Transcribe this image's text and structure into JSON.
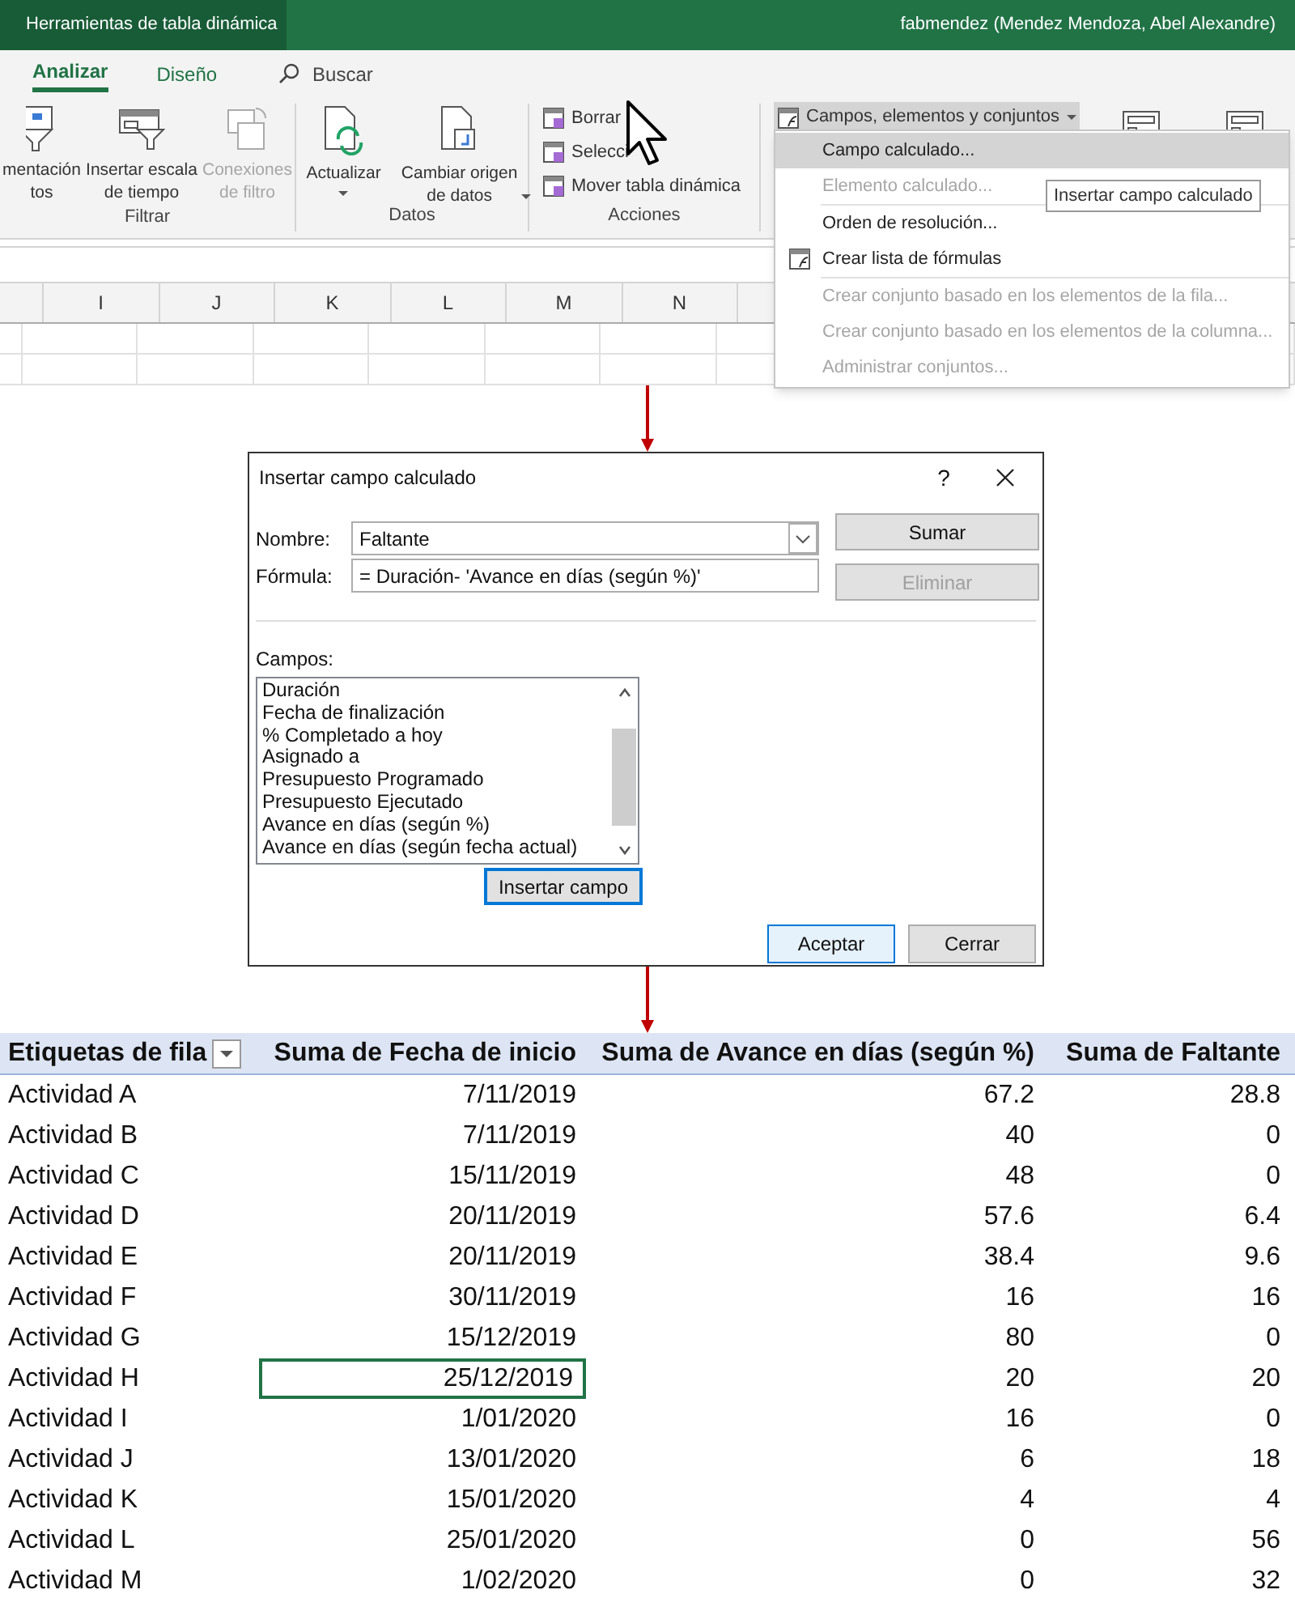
{
  "title_bar": {
    "context_tab": "Herramientas de tabla dinámica",
    "user": "fabmendez (Mendez Mendoza, Abel Alexandre)"
  },
  "ribbon_tabs": [
    {
      "label": "Analizar",
      "selected": true
    },
    {
      "label": "Diseño",
      "selected": false
    }
  ],
  "search": {
    "placeholder": "Buscar"
  },
  "ribbon_groups": [
    {
      "label": "Filtrar",
      "commands": [
        {
          "kind": "slicer",
          "lines": [
            "mentación",
            "tos"
          ],
          "disabled": false
        },
        {
          "kind": "timeline",
          "lines": [
            "Insertar escala",
            "de tiempo"
          ],
          "disabled": false
        },
        {
          "kind": "connections",
          "lines": [
            "Conexiones",
            "de filtro"
          ],
          "disabled": true
        }
      ]
    },
    {
      "label": "Datos",
      "commands": [
        {
          "kind": "refresh",
          "lines": [
            "Actualizar"
          ],
          "dropdown": true,
          "disabled": false
        },
        {
          "kind": "source",
          "lines": [
            "Cambiar origen",
            "de datos"
          ],
          "dropdown": true,
          "disabled": false
        }
      ]
    },
    {
      "label": "Acciones",
      "commands": [
        {
          "kind": "small",
          "lines": [
            "Borrar"
          ],
          "disabled": false
        },
        {
          "kind": "small",
          "lines": [
            "Selecci"
          ],
          "disabled": false
        },
        {
          "kind": "small",
          "lines": [
            "Mover tabla dinámica"
          ],
          "disabled": false
        }
      ]
    }
  ],
  "fields_button": {
    "label": "Campos, elementos y conjuntos",
    "expanded": true
  },
  "columns": [
    "I",
    "J",
    "K",
    "L",
    "M",
    "N"
  ],
  "menu": [
    {
      "label": "Campo calculado...",
      "selected": true,
      "disabled": false,
      "separator_before": false
    },
    {
      "label": "Elemento calculado...",
      "selected": false,
      "disabled": true,
      "separator_before": false
    },
    {
      "label": "Orden de resolución...",
      "selected": false,
      "disabled": false,
      "separator_before": true
    },
    {
      "label": "Crear lista de fórmulas",
      "selected": false,
      "disabled": false,
      "separator_before": false,
      "icon": true
    },
    {
      "label": "Crear conjunto basado en los elementos de la fila...",
      "selected": false,
      "disabled": true,
      "separator_before": true
    },
    {
      "label": "Crear conjunto basado en los elementos de la columna...",
      "selected": false,
      "disabled": true,
      "separator_before": false
    },
    {
      "label": "Administrar conjuntos...",
      "selected": false,
      "disabled": true,
      "separator_before": false
    }
  ],
  "tooltip": "Insertar campo calculado",
  "dialog": {
    "title": "Insertar campo calculado",
    "help": "?",
    "name": {
      "label": "Nombre:",
      "value": "Faltante"
    },
    "formula": {
      "label": "Fórmula:",
      "value": "= Duración- 'Avance en días (según %)'"
    },
    "side_buttons": [
      {
        "label": "Sumar",
        "disabled": false
      },
      {
        "label": "Eliminar",
        "disabled": true
      }
    ],
    "fields_label": "Campos:",
    "fields": [
      "Duración",
      "Fecha de finalización",
      "% Completado a hoy",
      "Asignado a",
      "Presupuesto Programado",
      "Presupuesto Ejecutado",
      "Avance en días (según %)",
      "Avance en días (según fecha actual)"
    ],
    "insert_button": "Insertar campo",
    "buttons": [
      {
        "label": "Aceptar",
        "default": true
      },
      {
        "label": "Cerrar",
        "default": false
      }
    ]
  },
  "pivot": {
    "headers": [
      "Etiquetas de fila",
      "Suma de Fecha de inicio",
      "Suma de Avance en días (según %)",
      "Suma de Faltante"
    ],
    "rows": [
      {
        "label": "Actividad A",
        "date": "7/11/2019",
        "days": "67.2",
        "missing": "28.8",
        "selected": false
      },
      {
        "label": "Actividad B",
        "date": "7/11/2019",
        "days": "40",
        "missing": "0",
        "selected": false
      },
      {
        "label": "Actividad C",
        "date": "15/11/2019",
        "days": "48",
        "missing": "0",
        "selected": false
      },
      {
        "label": "Actividad D",
        "date": "20/11/2019",
        "days": "57.6",
        "missing": "6.4",
        "selected": false
      },
      {
        "label": "Actividad E",
        "date": "20/11/2019",
        "days": "38.4",
        "missing": "9.6",
        "selected": false
      },
      {
        "label": "Actividad F",
        "date": "30/11/2019",
        "days": "16",
        "missing": "16",
        "selected": false
      },
      {
        "label": "Actividad G",
        "date": "15/12/2019",
        "days": "80",
        "missing": "0",
        "selected": false
      },
      {
        "label": "Actividad H",
        "date": "25/12/2019",
        "days": "20",
        "missing": "20",
        "selected": true
      },
      {
        "label": "Actividad I",
        "date": "1/01/2020",
        "days": "16",
        "missing": "0",
        "selected": false
      },
      {
        "label": "Actividad J",
        "date": "13/01/2020",
        "days": "6",
        "missing": "18",
        "selected": false
      },
      {
        "label": "Actividad K",
        "date": "15/01/2020",
        "days": "4",
        "missing": "4",
        "selected": false
      },
      {
        "label": "Actividad L",
        "date": "25/01/2020",
        "days": "0",
        "missing": "56",
        "selected": false
      },
      {
        "label": "Actividad M",
        "date": "1/02/2020",
        "days": "0",
        "missing": "32",
        "selected": false
      }
    ]
  }
}
